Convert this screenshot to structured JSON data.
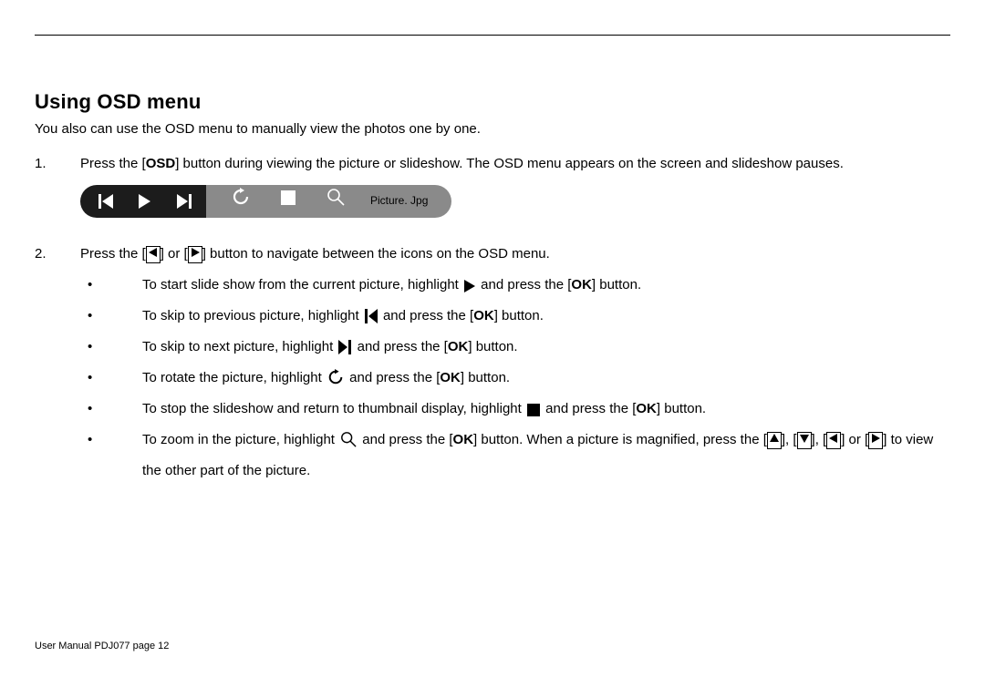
{
  "heading": "Using OSD menu",
  "intro": "You also can use the OSD menu to manually view the photos one by one.",
  "step1": {
    "num": "1.",
    "pre": "Press the [",
    "osd": "OSD",
    "post": "] button during viewing the picture or slideshow. The OSD menu appears on the screen and slideshow pauses."
  },
  "osd_filename": "Picture. Jpg",
  "step2": {
    "num": "2.",
    "pre": "Press the [",
    "mid": "] or [",
    "post": "] button to navigate between the icons on the OSD menu."
  },
  "b1": {
    "a": "To start slide show from the current picture, highlight ",
    "b": " and press the [",
    "ok": "OK",
    "c": "] button."
  },
  "b2": {
    "a": "To skip to previous picture, highlight ",
    "b": " and press the [",
    "ok": "OK",
    "c": "] button."
  },
  "b3": {
    "a": "To skip to next picture, highlight ",
    "b": " and press the [",
    "ok": "OK",
    "c": "] button."
  },
  "b4": {
    "a": "To rotate the picture, highlight ",
    "b": " and press the [",
    "ok": "OK",
    "c": "] button."
  },
  "b5": {
    "a": "To stop the slideshow and return to thumbnail display, highlight ",
    "b": " and press the [",
    "ok": "OK",
    "c": "] button."
  },
  "b6": {
    "a": "To zoom in the picture, highlight ",
    "b": " and press the [",
    "ok": "OK",
    "c": "] button. When a picture is magnified, press the [",
    "d": "], [",
    "e": "], [",
    "f": "] or [",
    "g": "] to view the other part of the picture."
  },
  "footer": "User Manual PDJ077 page 12"
}
